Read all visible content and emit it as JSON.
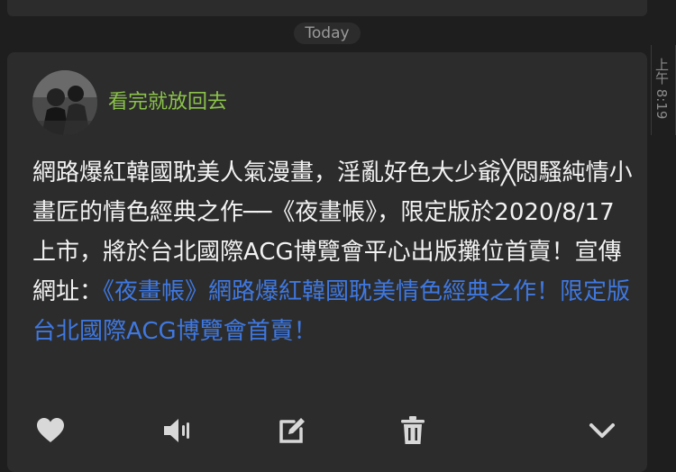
{
  "date_divider": "Today",
  "message": {
    "sender": "看完就放回去",
    "text": "網路爆紅韓國耽美人氣漫畫，淫亂好色大少爺╳悶騷純情小畫匠的情色經典之作──《夜畫帳》，限定版於2020/8/17上市，將於台北國際ACG博覽會平心出版攤位首賣！宣傳網址：",
    "link_text": "《夜畫帳》網路爆紅韓國耽美情色經典之作！限定版台北國際ACG博覽會首賣！",
    "timestamp": "上午 8:19"
  },
  "actions": [
    {
      "name": "like",
      "icon": "heart-icon"
    },
    {
      "name": "speak",
      "icon": "speaker-icon"
    },
    {
      "name": "edit",
      "icon": "edit-icon"
    },
    {
      "name": "delete",
      "icon": "trash-icon"
    },
    {
      "name": "expand",
      "icon": "chevron-down-icon"
    }
  ],
  "colors": {
    "background": "#1e1e1e",
    "card": "#2c2c2c",
    "sender": "#8bc34a",
    "link": "#3f78e0",
    "text": "#f2f2f2"
  }
}
